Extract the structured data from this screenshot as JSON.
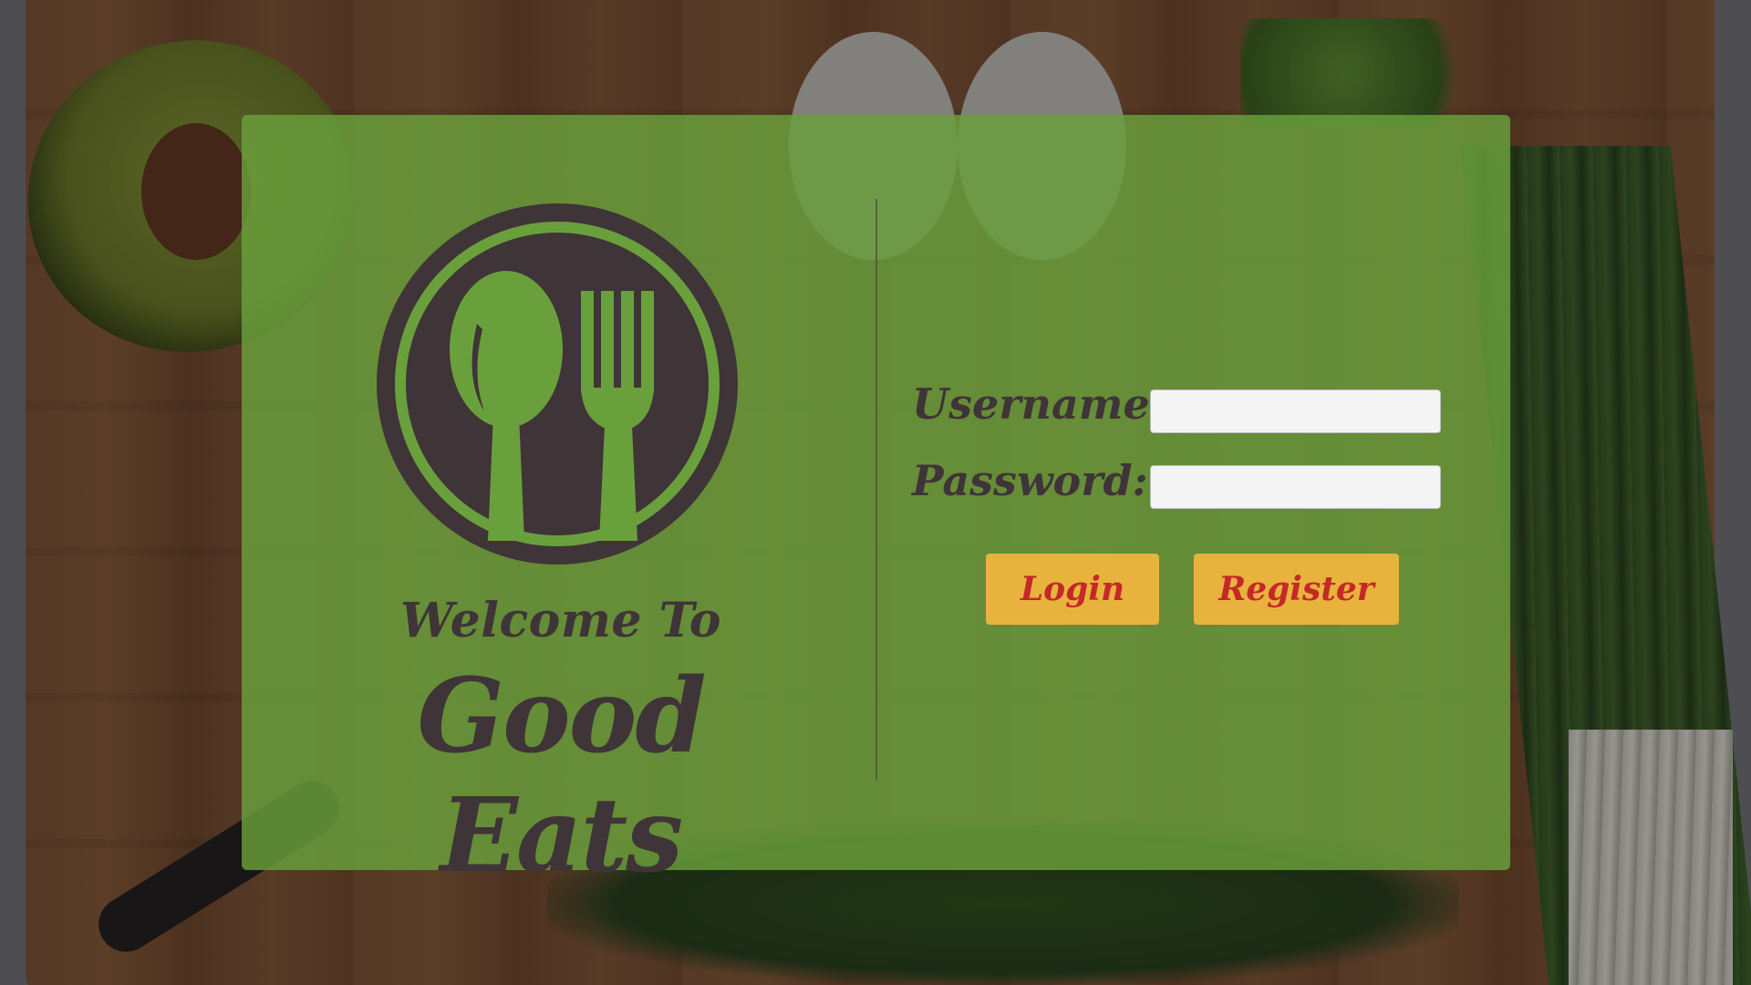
{
  "brand": {
    "welcome": "Welcome To",
    "name": "Good Eats",
    "logo_icon": "fork-and-spoon-icon"
  },
  "form": {
    "username_label": "Username:",
    "username_value": "",
    "password_label": "Password:",
    "password_value": "",
    "login_label": "Login",
    "register_label": "Register"
  },
  "colors": {
    "panel": "#6aa03c",
    "text_dark": "#3f3437",
    "button_bg": "#e8b33d",
    "button_text": "#c62828"
  }
}
